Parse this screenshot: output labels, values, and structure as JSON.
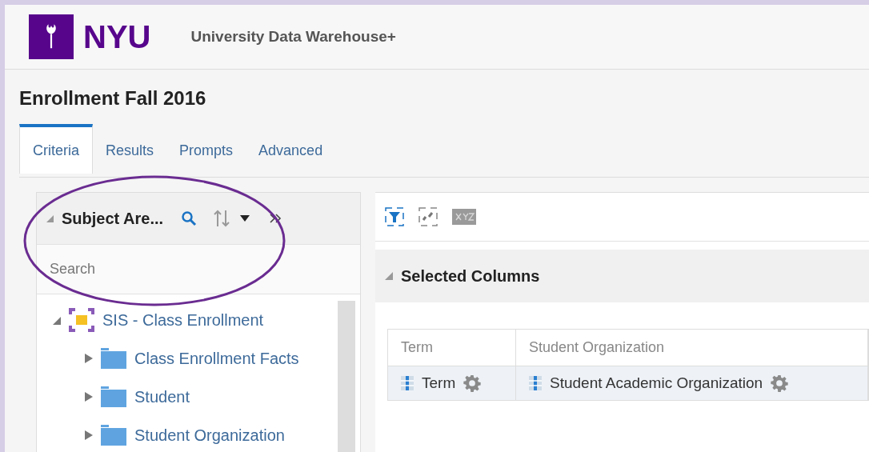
{
  "header": {
    "logo_text": "NYU",
    "app_title": "University Data Warehouse+"
  },
  "page_title": "Enrollment Fall 2016",
  "tabs": [
    {
      "label": "Criteria",
      "selected": true
    },
    {
      "label": "Results",
      "selected": false
    },
    {
      "label": "Prompts",
      "selected": false
    },
    {
      "label": "Advanced",
      "selected": false
    }
  ],
  "subject_areas": {
    "title": "Subject Are...",
    "search": {
      "placeholder": "Search"
    },
    "tree": [
      {
        "label": "SIS - Class Enrollment",
        "kind": "subject",
        "expanded": true,
        "children": [
          {
            "label": "Class Enrollment Facts",
            "kind": "folder",
            "expanded": false
          },
          {
            "label": "Student",
            "kind": "folder",
            "expanded": false
          },
          {
            "label": "Student Organization",
            "kind": "folder",
            "expanded": false
          }
        ]
      }
    ]
  },
  "selected_columns": {
    "title": "Selected Columns",
    "columns": [
      {
        "heading": "Term",
        "item": "Term"
      },
      {
        "heading": "Student Organization",
        "item": "Student Academic Organization"
      }
    ]
  }
}
